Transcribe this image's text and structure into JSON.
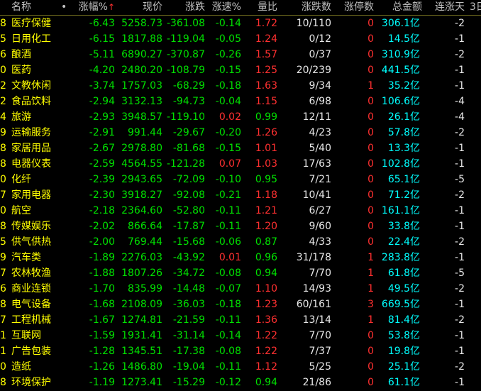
{
  "headers": {
    "name": "名称",
    "dot": "•",
    "pct": "涨幅%",
    "sort_arrow": "↑",
    "price": "现价",
    "change": "涨跌",
    "speed": "涨速%",
    "vol_ratio": "量比",
    "updown": "涨跌数",
    "limit": "涨停数",
    "amount": "总金额",
    "streak": "连涨天",
    "extra": "3日"
  },
  "colors": {
    "background": "#000000",
    "name_text": "#ffff00",
    "down": "#00e000",
    "up": "#ff3030",
    "neutral": "#e8e8e8",
    "amount": "#00ffff"
  },
  "rows": [
    {
      "idx": "8",
      "name": "医疗保健",
      "pct": "-6.43",
      "price": "5258.73",
      "change": "-361.08",
      "speed": "-0.14",
      "speed_dir": "down",
      "vol": "1.72",
      "vol_dir": "up",
      "updown": "10/110",
      "limit": "0",
      "amount": "306.1",
      "unit": "亿",
      "streak": "-2"
    },
    {
      "idx": "5",
      "name": "日用化工",
      "pct": "-6.15",
      "price": "1817.88",
      "change": "-119.04",
      "speed": "-0.05",
      "speed_dir": "down",
      "vol": "1.24",
      "vol_dir": "up",
      "updown": "0/12",
      "limit": "0",
      "amount": "14.5",
      "unit": "亿",
      "streak": "-1"
    },
    {
      "idx": "6",
      "name": "酿酒",
      "pct": "-5.11",
      "price": "6890.27",
      "change": "-370.87",
      "speed": "-0.26",
      "speed_dir": "down",
      "vol": "1.57",
      "vol_dir": "up",
      "updown": "0/37",
      "limit": "0",
      "amount": "310.9",
      "unit": "亿",
      "streak": "-2"
    },
    {
      "idx": "0",
      "name": "医药",
      "pct": "-4.20",
      "price": "2480.20",
      "change": "-108.79",
      "speed": "-0.15",
      "speed_dir": "down",
      "vol": "1.25",
      "vol_dir": "up",
      "updown": "20/239",
      "limit": "0",
      "amount": "441.5",
      "unit": "亿",
      "streak": "-1"
    },
    {
      "idx": "2",
      "name": "文教休闲",
      "pct": "-3.74",
      "price": "1757.03",
      "change": "-68.29",
      "speed": "-0.18",
      "speed_dir": "down",
      "vol": "1.63",
      "vol_dir": "up",
      "updown": "9/34",
      "limit": "1",
      "amount": "35.2",
      "unit": "亿",
      "streak": "-1"
    },
    {
      "idx": "2",
      "name": "食品饮料",
      "pct": "-2.94",
      "price": "3132.13",
      "change": "-94.73",
      "speed": "-0.04",
      "speed_dir": "down",
      "vol": "1.15",
      "vol_dir": "up",
      "updown": "6/98",
      "limit": "0",
      "amount": "106.6",
      "unit": "亿",
      "streak": "-4"
    },
    {
      "idx": "4",
      "name": "旅游",
      "pct": "-2.93",
      "price": "3948.57",
      "change": "-119.10",
      "speed": "0.02",
      "speed_dir": "up",
      "vol": "0.99",
      "vol_dir": "down",
      "updown": "12/11",
      "limit": "0",
      "amount": "26.1",
      "unit": "亿",
      "streak": "-4"
    },
    {
      "idx": "9",
      "name": "运输服务",
      "pct": "-2.91",
      "price": "991.44",
      "change": "-29.67",
      "speed": "-0.20",
      "speed_dir": "down",
      "vol": "1.26",
      "vol_dir": "up",
      "updown": "4/23",
      "limit": "0",
      "amount": "57.8",
      "unit": "亿",
      "streak": "-2"
    },
    {
      "idx": "8",
      "name": "家居用品",
      "pct": "-2.67",
      "price": "2978.80",
      "change": "-81.68",
      "speed": "-0.15",
      "speed_dir": "down",
      "vol": "1.01",
      "vol_dir": "up",
      "updown": "5/40",
      "limit": "0",
      "amount": "13.3",
      "unit": "亿",
      "streak": "-1"
    },
    {
      "idx": "8",
      "name": "电器仪表",
      "pct": "-2.59",
      "price": "4564.55",
      "change": "-121.28",
      "speed": "0.07",
      "speed_dir": "up",
      "vol": "1.03",
      "vol_dir": "up",
      "updown": "17/63",
      "limit": "0",
      "amount": "102.8",
      "unit": "亿",
      "streak": "-1"
    },
    {
      "idx": "0",
      "name": "化纤",
      "pct": "-2.39",
      "price": "2943.65",
      "change": "-72.09",
      "speed": "-0.10",
      "speed_dir": "down",
      "vol": "0.95",
      "vol_dir": "down",
      "updown": "7/21",
      "limit": "0",
      "amount": "65.1",
      "unit": "亿",
      "streak": "-5"
    },
    {
      "idx": "7",
      "name": "家用电器",
      "pct": "-2.30",
      "price": "3918.27",
      "change": "-92.08",
      "speed": "-0.21",
      "speed_dir": "down",
      "vol": "1.18",
      "vol_dir": "up",
      "updown": "10/41",
      "limit": "0",
      "amount": "71.2",
      "unit": "亿",
      "streak": "-2"
    },
    {
      "idx": "0",
      "name": "航空",
      "pct": "-2.18",
      "price": "2364.60",
      "change": "-52.80",
      "speed": "-0.11",
      "speed_dir": "down",
      "vol": "1.21",
      "vol_dir": "up",
      "updown": "6/27",
      "limit": "0",
      "amount": "161.1",
      "unit": "亿",
      "streak": "-1"
    },
    {
      "idx": "8",
      "name": "传媒娱乐",
      "pct": "-2.02",
      "price": "866.64",
      "change": "-17.87",
      "speed": "-0.11",
      "speed_dir": "down",
      "vol": "1.20",
      "vol_dir": "up",
      "updown": "9/60",
      "limit": "0",
      "amount": "33.8",
      "unit": "亿",
      "streak": "-1"
    },
    {
      "idx": "5",
      "name": "供气供热",
      "pct": "-2.00",
      "price": "769.44",
      "change": "-15.68",
      "speed": "-0.06",
      "speed_dir": "down",
      "vol": "0.87",
      "vol_dir": "down",
      "updown": "4/33",
      "limit": "0",
      "amount": "22.4",
      "unit": "亿",
      "streak": "-2"
    },
    {
      "idx": "9",
      "name": "汽车类",
      "pct": "-1.89",
      "price": "2276.03",
      "change": "-43.92",
      "speed": "0.01",
      "speed_dir": "up",
      "vol": "0.96",
      "vol_dir": "down",
      "updown": "31/178",
      "limit": "1",
      "amount": "283.8",
      "unit": "亿",
      "streak": "-1"
    },
    {
      "idx": "7",
      "name": "农林牧渔",
      "pct": "-1.88",
      "price": "1807.26",
      "change": "-34.72",
      "speed": "-0.08",
      "speed_dir": "down",
      "vol": "0.94",
      "vol_dir": "down",
      "updown": "7/70",
      "limit": "1",
      "amount": "61.8",
      "unit": "亿",
      "streak": "-5"
    },
    {
      "idx": "6",
      "name": "商业连锁",
      "pct": "-1.70",
      "price": "835.99",
      "change": "-14.48",
      "speed": "-0.07",
      "speed_dir": "down",
      "vol": "1.10",
      "vol_dir": "up",
      "updown": "14/93",
      "limit": "1",
      "amount": "49.5",
      "unit": "亿",
      "streak": "-2"
    },
    {
      "idx": "8",
      "name": "电气设备",
      "pct": "-1.68",
      "price": "2108.09",
      "change": "-36.03",
      "speed": "-0.18",
      "speed_dir": "down",
      "vol": "1.23",
      "vol_dir": "up",
      "updown": "60/161",
      "limit": "3",
      "amount": "669.5",
      "unit": "亿",
      "streak": "-1"
    },
    {
      "idx": "7",
      "name": "工程机械",
      "pct": "-1.67",
      "price": "1274.81",
      "change": "-21.59",
      "speed": "-0.11",
      "speed_dir": "down",
      "vol": "1.36",
      "vol_dir": "up",
      "updown": "13/14",
      "limit": "1",
      "amount": "81.4",
      "unit": "亿",
      "streak": "-2"
    },
    {
      "idx": "1",
      "name": "互联网",
      "pct": "-1.59",
      "price": "1931.41",
      "change": "-31.14",
      "speed": "-0.14",
      "speed_dir": "down",
      "vol": "1.22",
      "vol_dir": "up",
      "updown": "7/70",
      "limit": "0",
      "amount": "53.8",
      "unit": "亿",
      "streak": "-1"
    },
    {
      "idx": "1",
      "name": "广告包装",
      "pct": "-1.28",
      "price": "1345.51",
      "change": "-17.38",
      "speed": "-0.08",
      "speed_dir": "down",
      "vol": "1.22",
      "vol_dir": "up",
      "updown": "7/37",
      "limit": "0",
      "amount": "19.8",
      "unit": "亿",
      "streak": "-1"
    },
    {
      "idx": "0",
      "name": "造纸",
      "pct": "-1.26",
      "price": "1486.80",
      "change": "-19.04",
      "speed": "-0.11",
      "speed_dir": "down",
      "vol": "1.12",
      "vol_dir": "up",
      "updown": "5/25",
      "limit": "0",
      "amount": "25.1",
      "unit": "亿",
      "streak": "-2"
    },
    {
      "idx": "8",
      "name": "环境保护",
      "pct": "-1.19",
      "price": "1273.41",
      "change": "-15.29",
      "speed": "-0.12",
      "speed_dir": "down",
      "vol": "0.94",
      "vol_dir": "down",
      "updown": "21/86",
      "limit": "0",
      "amount": "61.1",
      "unit": "亿",
      "streak": "-1"
    }
  ]
}
